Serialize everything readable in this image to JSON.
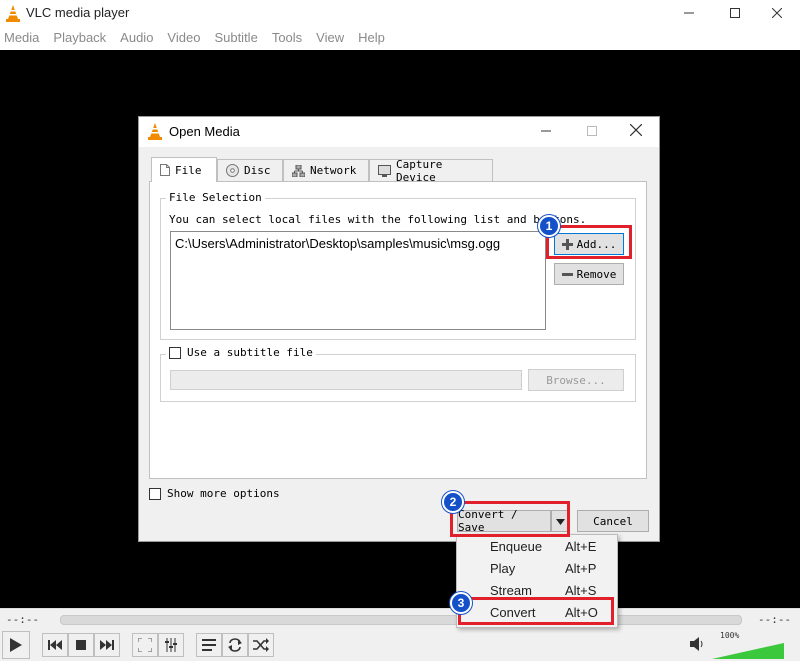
{
  "window": {
    "title": "VLC media player"
  },
  "menu": [
    "Media",
    "Playback",
    "Audio",
    "Video",
    "Subtitle",
    "Tools",
    "View",
    "Help"
  ],
  "dialog": {
    "title": "Open Media",
    "tabs": [
      {
        "label": "File",
        "icon": "file-icon",
        "active": true
      },
      {
        "label": "Disc",
        "icon": "disc-icon"
      },
      {
        "label": "Network",
        "icon": "network-icon"
      },
      {
        "label": "Capture Device",
        "icon": "capture-device-icon"
      }
    ],
    "file_selection": {
      "group_label": "File Selection",
      "hint": "You can select local files with the following list and buttons.",
      "files": [
        "C:\\Users\\Administrator\\Desktop\\samples\\music\\msg.ogg"
      ],
      "add_label": "Add...",
      "remove_label": "Remove"
    },
    "subtitle": {
      "checkbox_label": "Use a subtitle file",
      "path_value": "",
      "browse_label": "Browse..."
    },
    "show_more_label": "Show more options",
    "convert_save_label": "Convert / Save",
    "cancel_label": "Cancel"
  },
  "dropdown": [
    {
      "label": "Enqueue",
      "shortcut": "Alt+E"
    },
    {
      "label": "Play",
      "shortcut": "Alt+P"
    },
    {
      "label": "Stream",
      "shortcut": "Alt+S"
    },
    {
      "label": "Convert",
      "shortcut": "Alt+O"
    }
  ],
  "annotations": {
    "step1": "1",
    "step2": "2",
    "step3": "3",
    "highlight_color": "#e0202a",
    "badge_color": "#1450c8"
  },
  "player": {
    "time_elapsed": "--:--",
    "time_total": "--:--",
    "volume_label": "100%",
    "volume_level": 1.0
  },
  "colors": {
    "vlc_orange": "#f08a00",
    "video_bg": "#000000",
    "volume_green": "#3cc83c"
  }
}
